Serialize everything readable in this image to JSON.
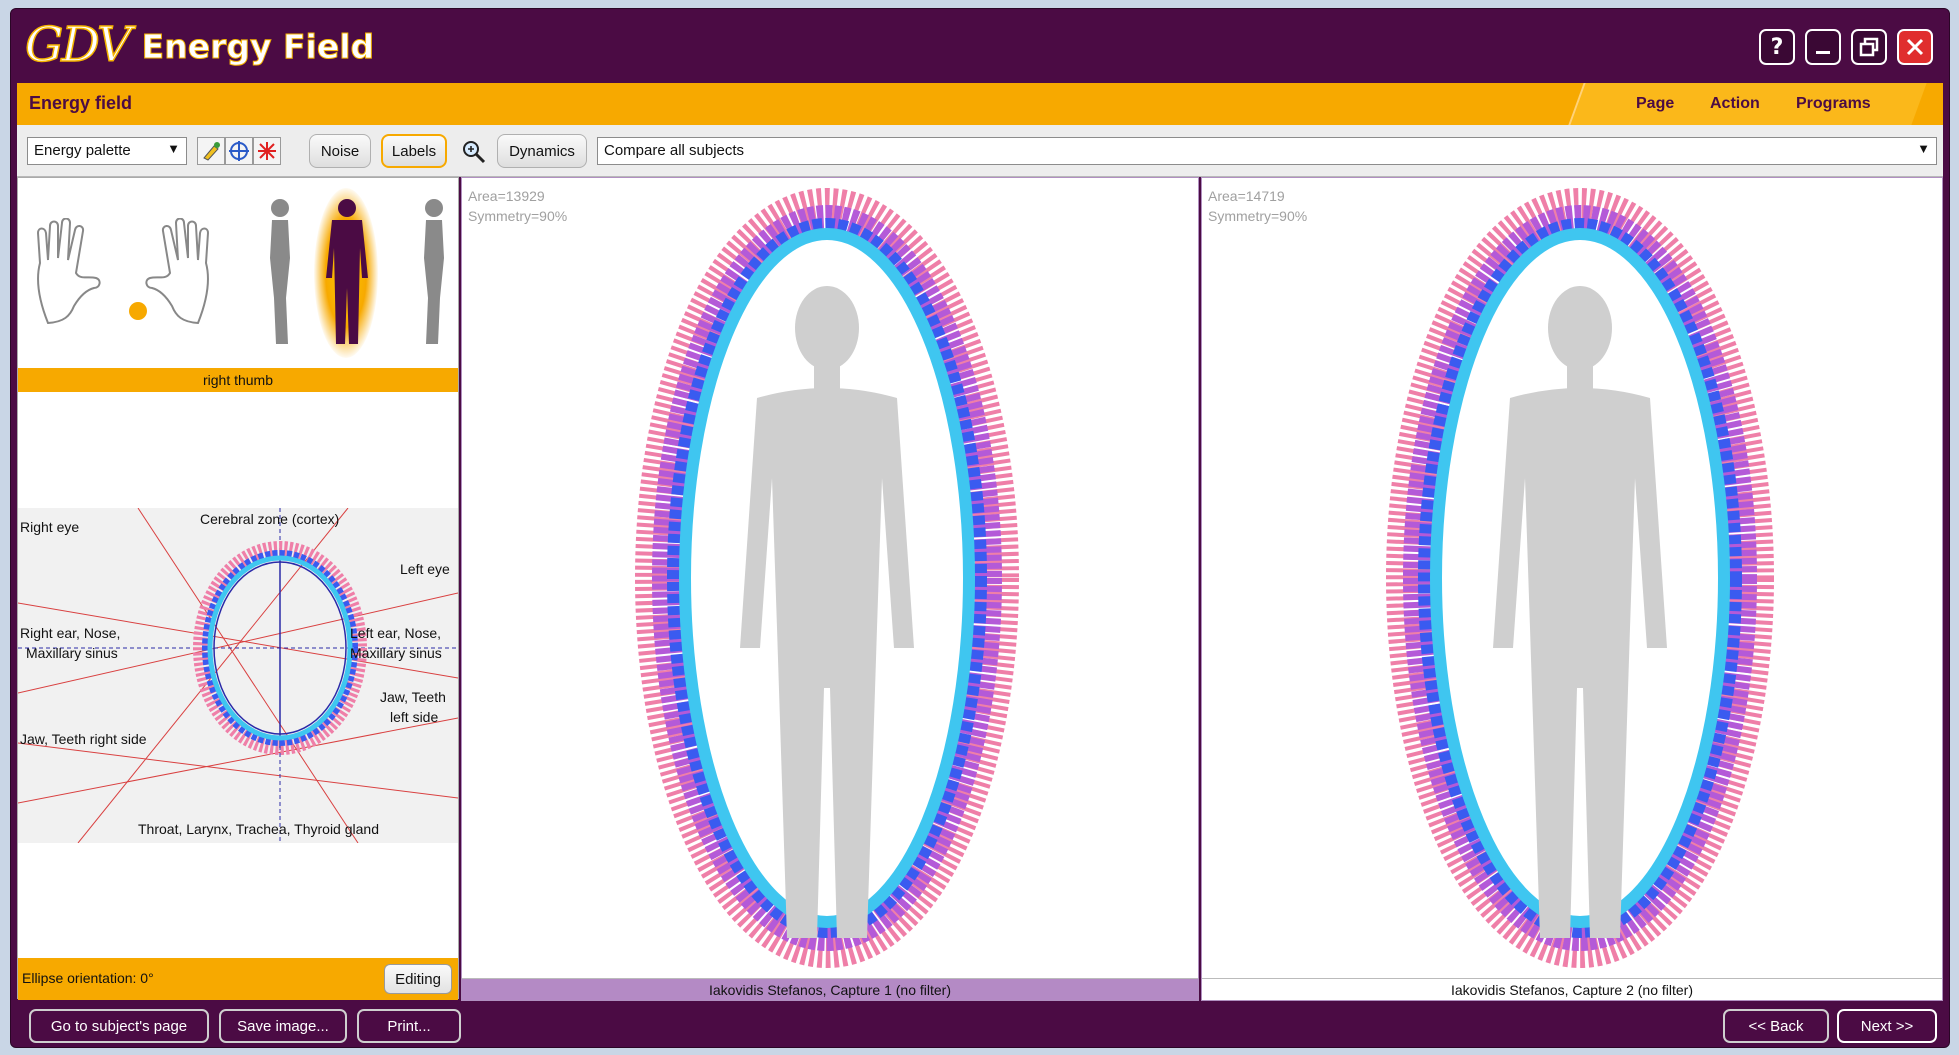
{
  "app": {
    "logo": "GDV",
    "title": "Energy Field",
    "window_buttons": [
      "help-icon",
      "minimize-icon",
      "restore-icon",
      "close-icon"
    ]
  },
  "header": {
    "section_title": "Energy field",
    "menu": [
      "Page",
      "Action",
      "Programs"
    ]
  },
  "toolbar": {
    "palette_value": "Energy palette",
    "icons": [
      "brush-icon",
      "target-icon",
      "asterisk-icon"
    ],
    "noise_label": "Noise",
    "labels_label": "Labels",
    "zoom_icon": "zoom-icon",
    "dynamics_label": "Dynamics",
    "compare_value": "Compare all subjects"
  },
  "left_panel": {
    "selected_caption": "right thumb",
    "diagram_labels": {
      "top": "Cerebral zone (cortex)",
      "right_eye": "Right eye",
      "left_eye": "Left eye",
      "right_ear_1": "Right ear, Nose,",
      "right_ear_2": "Maxillary sinus",
      "left_ear_1": "Left ear, Nose,",
      "left_ear_2": "Maxillary sinus",
      "jaw_right": "Jaw, Teeth right side",
      "jaw_left_1": "Jaw, Teeth",
      "jaw_left_2": "left side",
      "bottom": "Throat, Larynx, Trachea, Thyroid gland"
    },
    "orientation": "Ellipse orientation: 0°",
    "editing_label": "Editing"
  },
  "captures": [
    {
      "area": "Area=13929",
      "symmetry": "Symmetry=90%",
      "caption": "Iakovidis Stefanos, Capture 1 (no filter)"
    },
    {
      "area": "Area=14719",
      "symmetry": "Symmetry=90%",
      "caption": "Iakovidis Stefanos, Capture 2 (no filter)"
    }
  ],
  "bottom": {
    "go_subject": "Go to subject's page",
    "save_image": "Save image...",
    "print": "Print...",
    "back": "<< Back",
    "next": "Next >>"
  },
  "colors": {
    "frame": "#4b0b44",
    "accent": "#f7a900",
    "glow_cyan": "#3fc6f0",
    "glow_blue": "#3a5bf0",
    "glow_purple": "#b45ad8",
    "glow_pink": "#ef7fa8",
    "silhouette": "#cfcfcf"
  }
}
